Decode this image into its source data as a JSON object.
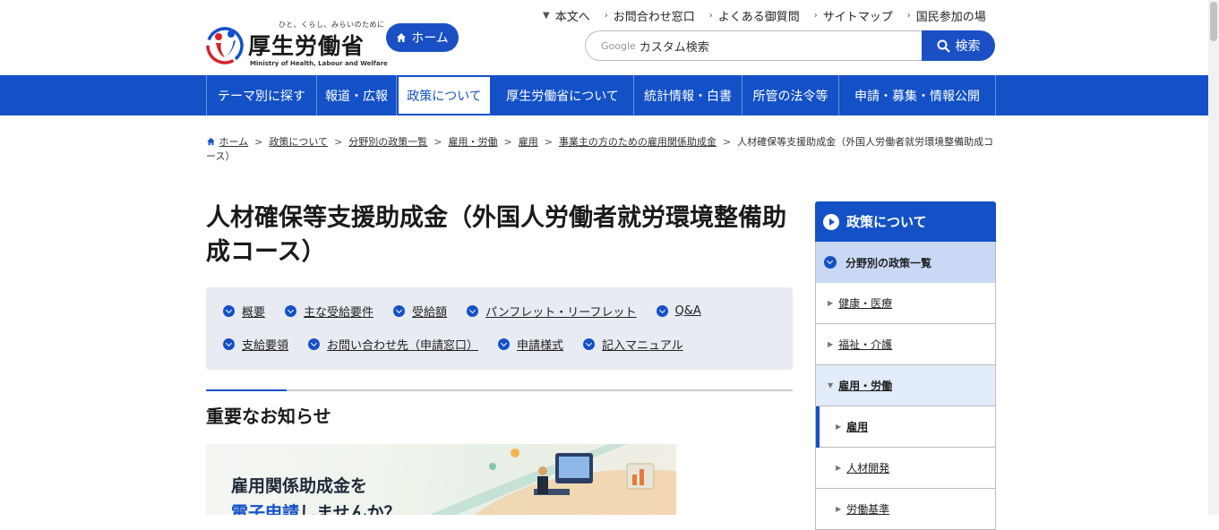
{
  "header": {
    "logo_tagline": "ひと、くらし、みらいのために",
    "logo_name": "厚生労働省",
    "logo_name_en": "Ministry of Health, Labour and Welfare",
    "home_label": "ホーム",
    "util_nav": [
      "本文へ",
      "お問合わせ窓口",
      "よくある御質問",
      "サイトマップ",
      "国民参加の場"
    ],
    "search_google": "Google",
    "search_placeholder": "カスタム検索",
    "search_button": "検索"
  },
  "gnav": {
    "items": [
      "テーマ別に探す",
      "報道・広報",
      "政策について",
      "厚生労働省について",
      "統計情報・白書",
      "所管の法令等",
      "申請・募集・情報公開"
    ],
    "active": "政策について"
  },
  "breadcrumb": {
    "items": [
      "ホーム",
      "政策について",
      "分野別の政策一覧",
      "雇用・労働",
      "雇用",
      "事業主の方のための雇用関係助成金"
    ],
    "current": "人材確保等支援助成金（外国人労働者就労環境整備助成コース）"
  },
  "main": {
    "title": "人材確保等支援助成金（外国人労働者就労環境整備助成コース）",
    "anchors_row1": [
      "概要",
      "主な受給要件",
      "受給額",
      "パンフレット・リーフレット",
      "Q&A"
    ],
    "anchors_row2": [
      "支給要領",
      "お問い合わせ先（申請窓口）",
      "申請様式",
      "記入マニュアル"
    ],
    "section_title": "重要なお知らせ",
    "banner_line1": "雇用関係助成金を",
    "banner_line2_highlight": "電子申請",
    "banner_line2_rest": "しませんか？"
  },
  "side_nav": {
    "head": "政策について",
    "sub": "分野別の政策一覧",
    "items": [
      "健康・医療",
      "福祉・介護",
      "雇用・労働"
    ],
    "children": [
      "雇用",
      "人材開発",
      "労働基準"
    ]
  },
  "colors": {
    "brand_blue": "#1451c7",
    "nav_blue": "#1451c7",
    "side_sub_bg": "#c8d8f5",
    "anchor_bg": "#e8ebf1"
  }
}
